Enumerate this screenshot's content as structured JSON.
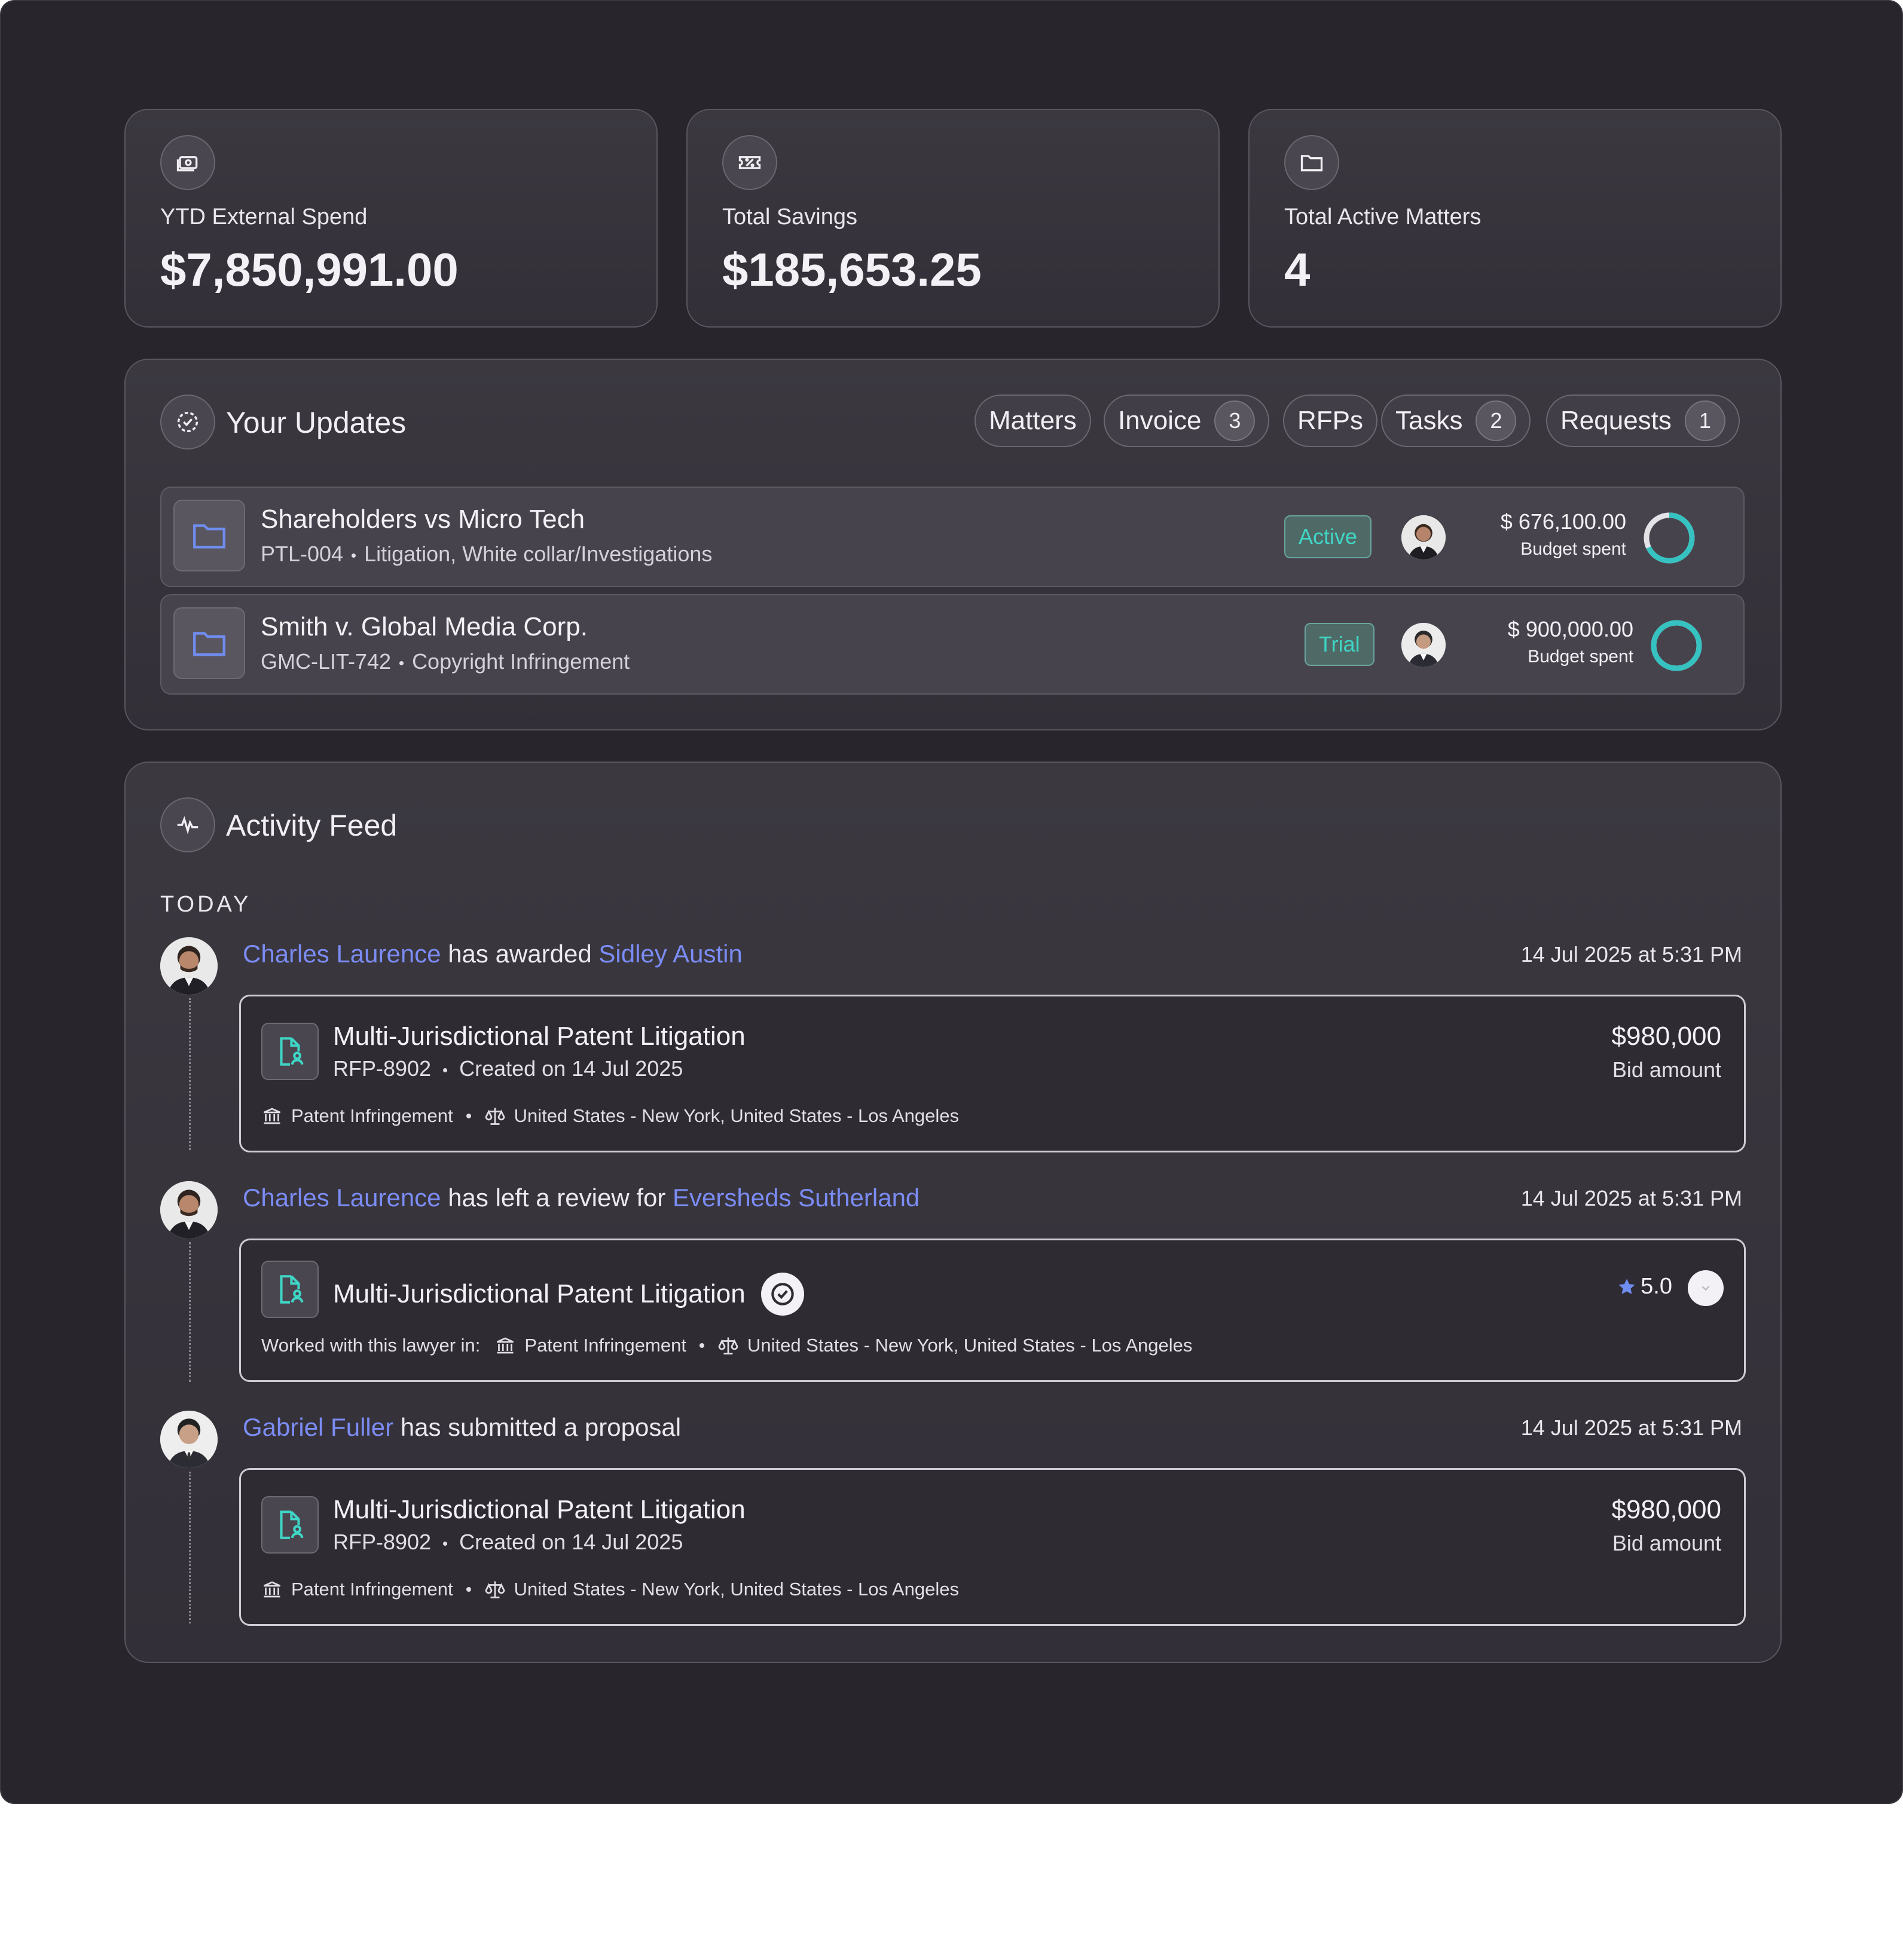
{
  "stats": [
    {
      "label": "YTD External Spend",
      "value": "$7,850,991.00",
      "icon": "money-icon"
    },
    {
      "label": "Total Savings",
      "value": "$185,653.25",
      "icon": "ticket-percent-icon"
    },
    {
      "label": "Total Active Matters",
      "value": "4",
      "icon": "folder-icon"
    }
  ],
  "updates": {
    "title": "Your Updates",
    "tabs": [
      {
        "label": "Matters",
        "count": ""
      },
      {
        "label": "Invoice",
        "count": "3"
      },
      {
        "label": "RFPs",
        "count": ""
      },
      {
        "label": "Tasks",
        "count": "2"
      },
      {
        "label": "Requests",
        "count": "1"
      }
    ],
    "matters": [
      {
        "title": "Shareholders vs Micro Tech",
        "code": "PTL-004",
        "areas": "Litigation, White collar/Investigations",
        "status": "Active",
        "budget": "$ 676,100.00",
        "budget_label": "Budget spent",
        "budget_progress": 0.68
      },
      {
        "title": "Smith v. Global Media Corp.",
        "code": "GMC-LIT-742",
        "areas": "Copyright Infringement",
        "status": "Trial",
        "budget": "$ 900,000.00",
        "budget_label": "Budget spent",
        "budget_progress": 1.0
      }
    ]
  },
  "feed": {
    "title": "Activity Feed",
    "group_label": "TODAY",
    "items": [
      {
        "actor": "Charles Laurence",
        "action": " has awarded ",
        "target": "Sidley Austin",
        "time": "14 Jul 2025 at 5:31 PM",
        "card": {
          "title": "Multi-Jurisdictional Patent Litigation",
          "code": "RFP-8902",
          "created": "Created on 14 Jul 2025",
          "practice": "Patent Infringement",
          "locations": "United States - New York, United States - Los Angeles",
          "amount": "$980,000",
          "amount_label": "Bid amount"
        }
      },
      {
        "actor": "Charles Laurence",
        "action": " has left a review for ",
        "target": "Eversheds Sutherland",
        "time": "14 Jul 2025 at 5:31 PM",
        "card": {
          "title": "Multi-Jurisdictional Patent Litigation",
          "worked_label": "Worked with this lawyer in:",
          "practice": "Patent Infringement",
          "locations": "United States - New York, United States - Los Angeles",
          "rating": "5.0"
        }
      },
      {
        "actor": "Gabriel Fuller",
        "action": " has submitted a proposal",
        "target": "",
        "time": "14 Jul 2025 at 5:31 PM",
        "card": {
          "title": "Multi-Jurisdictional Patent Litigation",
          "code": "RFP-8902",
          "created": "Created on 14 Jul 2025",
          "practice": "Patent Infringement",
          "locations": "United States - New York, United States - Los Angeles",
          "amount": "$980,000",
          "amount_label": "Bid amount"
        }
      }
    ]
  },
  "colors": {
    "background": "#28252d",
    "link": "#7b8cf4",
    "accent_teal": "#3fd6c6",
    "folder_blue": "#6f8df0"
  }
}
